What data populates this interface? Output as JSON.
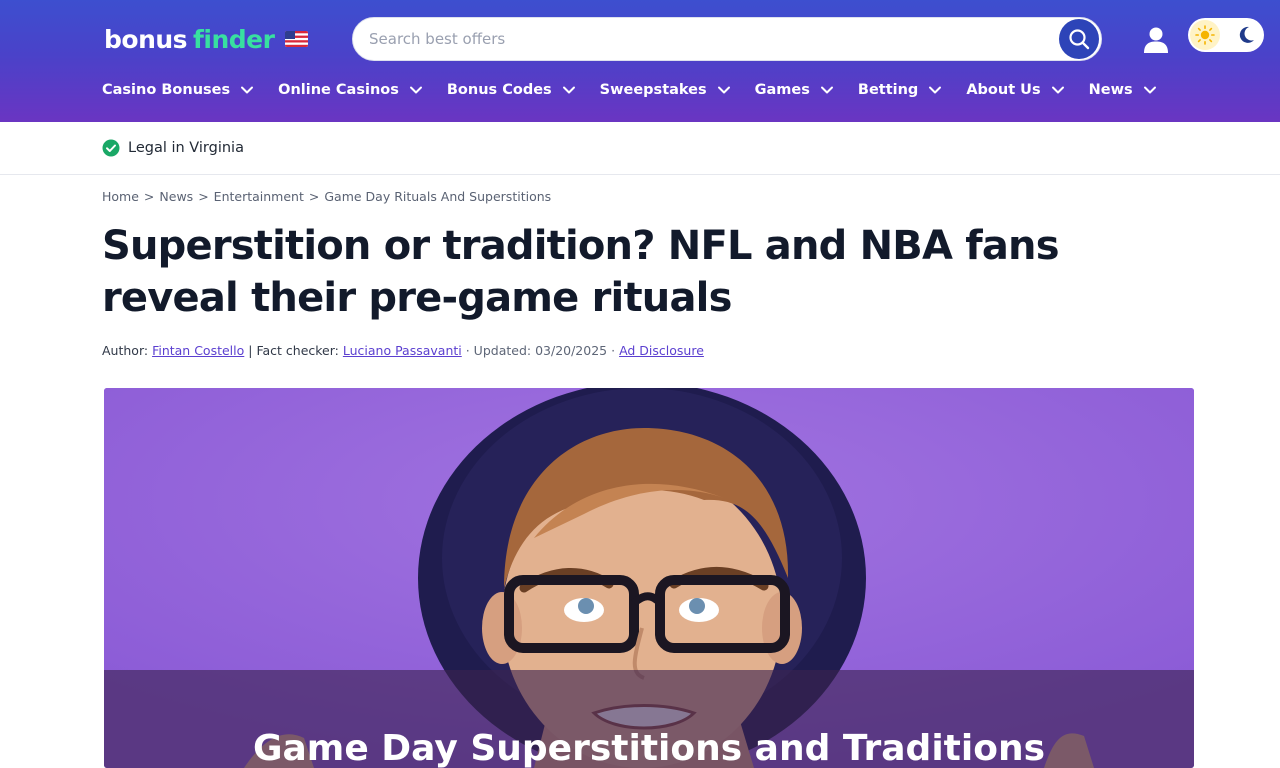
{
  "header": {
    "logo": {
      "bonus": "bonus",
      "finder": "finder"
    },
    "search": {
      "placeholder": "Search best offers"
    },
    "nav": [
      {
        "label": "Casino Bonuses"
      },
      {
        "label": "Online Casinos"
      },
      {
        "label": "Bonus Codes"
      },
      {
        "label": "Sweepstakes"
      },
      {
        "label": "Games"
      },
      {
        "label": "Betting"
      },
      {
        "label": "About Us"
      },
      {
        "label": "News"
      }
    ]
  },
  "legal": {
    "text": "Legal in Virginia"
  },
  "breadcrumb": {
    "items": [
      "Home",
      "News",
      "Entertainment"
    ],
    "separator": ">",
    "current": "Game Day Rituals And Superstitions"
  },
  "article": {
    "title": "Superstition or tradition? NFL and NBA fans reveal their pre-game rituals",
    "byline": {
      "author_prefix": "Author:",
      "author": "Fintan Costello",
      "fact_prefix": "| Fact checker:",
      "fact_checker": "Luciano Passavanti",
      "updated": "· Updated: 03/20/2025 ·",
      "disclosure": "Ad Disclosure"
    },
    "hero": {
      "caption": "Game Day Superstitions and Traditions"
    }
  },
  "colors": {
    "header_start": "#3d4fcf",
    "header_end": "#6a35c2",
    "logo_accent": "#38e0a0",
    "link": "#5b3fd0",
    "legal_check": "#1aa866",
    "hero_bg": "#8e5fd8"
  },
  "icons": [
    "us-flag-icon",
    "search-icon",
    "user-icon",
    "sun-icon",
    "moon-icon",
    "chevron-down-icon",
    "check-circle-icon"
  ]
}
